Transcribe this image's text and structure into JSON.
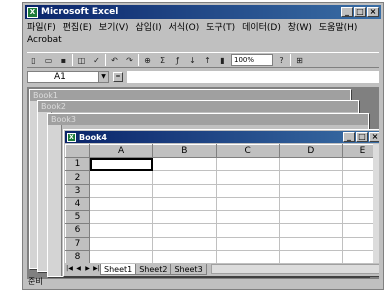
{
  "app": {
    "title": "Microsoft Excel",
    "icon": "excel-icon",
    "window_controls": {
      "minimize": "_",
      "restore": "□",
      "close": "×"
    }
  },
  "menu": [
    "파일(F)",
    "편집(E)",
    "보기(V)",
    "삽입(I)",
    "서식(O)",
    "도구(T)",
    "데이터(D)",
    "창(W)",
    "도움말(H)",
    "Acrobat"
  ],
  "toolbar": {
    "zoom": "100%"
  },
  "formula_bar": {
    "name_box": "A1"
  },
  "background_windows": [
    "Book1",
    "Book2",
    "Book3"
  ],
  "active_window": {
    "title": "Book4",
    "columns": [
      "A",
      "B",
      "C",
      "D",
      "E"
    ],
    "rows": [
      "1",
      "2",
      "3",
      "4",
      "5",
      "6",
      "7",
      "8"
    ],
    "selected_cell": "A1",
    "sheets": [
      "Sheet1",
      "Sheet2",
      "Sheet3"
    ],
    "active_sheet": "Sheet1"
  },
  "status": "준비"
}
